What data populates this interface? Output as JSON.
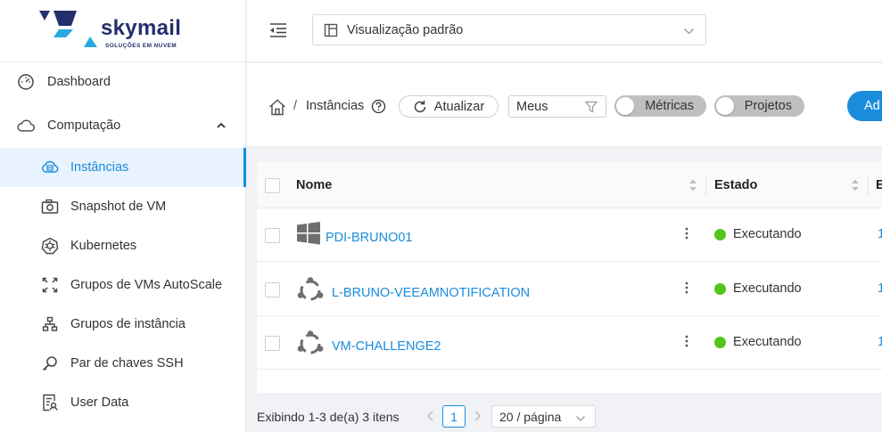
{
  "brand": {
    "name": "skymail",
    "tagline": "SOLUÇÕES EM NUVEM"
  },
  "sidebar": {
    "items": [
      {
        "label": "Dashboard",
        "icon": "dashboard-icon"
      },
      {
        "label": "Computação",
        "icon": "cloud-icon",
        "expanded": true
      },
      {
        "label": "Instâncias",
        "icon": "instance-cloud-icon",
        "active": true
      },
      {
        "label": "Snapshot de VM",
        "icon": "camera-icon"
      },
      {
        "label": "Kubernetes",
        "icon": "kubernetes-icon"
      },
      {
        "label": "Grupos de VMs AutoScale",
        "icon": "autoscale-icon"
      },
      {
        "label": "Grupos de instância",
        "icon": "cluster-icon"
      },
      {
        "label": "Par de chaves SSH",
        "icon": "key-icon"
      },
      {
        "label": "User Data",
        "icon": "user-data-icon"
      }
    ]
  },
  "header": {
    "view_selector": "Visualização padrão"
  },
  "toolbar": {
    "breadcrumb": "Instâncias",
    "breadcrumb_sep": "/",
    "refresh_label": "Atualizar",
    "filter_value": "Meus",
    "toggle_metrics": "Métricas",
    "toggle_projects": "Projetos",
    "add_label": "Ad"
  },
  "table": {
    "columns": [
      "Nome",
      "Estado",
      "E"
    ],
    "rows": [
      {
        "name": "PDI-BRUNO01",
        "os": "windows",
        "status": "Executando",
        "ip": "1"
      },
      {
        "name": "L-BRUNO-VEEAMNOTIFICATION",
        "os": "ubuntu",
        "status": "Executando",
        "ip": "1"
      },
      {
        "name": "VM-CHALLENGE2",
        "os": "ubuntu",
        "status": "Executando",
        "ip": "1"
      }
    ]
  },
  "pagination": {
    "info": "Exibindo 1-3 de(a) 3 itens",
    "current_page": "1",
    "page_size": "20 / página"
  },
  "colors": {
    "accent": "#1a8cdc",
    "active_bg": "#e8f3fd",
    "status_running": "#52c41a",
    "toggle_off": "#bfbfbf",
    "brand_navy": "#232f6b",
    "brand_cyan": "#29a9e1"
  }
}
